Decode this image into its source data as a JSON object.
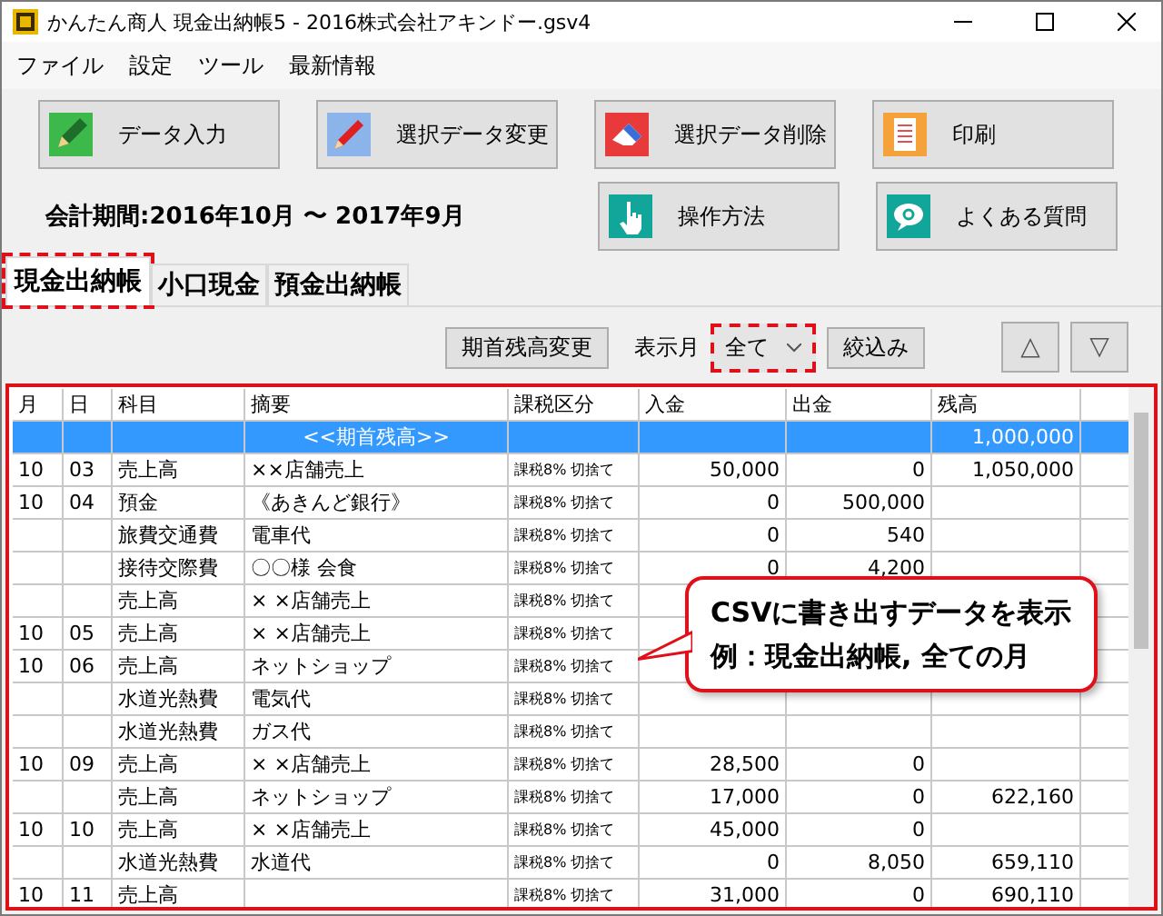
{
  "window": {
    "title": "かんたん商人 現金出納帳5 - 2016株式会社アキンドー.gsv4"
  },
  "menu": [
    "ファイル",
    "設定",
    "ツール",
    "最新情報"
  ],
  "buttons": [
    {
      "label": "データ入力",
      "kind": "pencil"
    },
    {
      "label": "選択データ変更",
      "kind": "pen"
    },
    {
      "label": "選択データ削除",
      "kind": "eraser"
    },
    {
      "label": "印刷",
      "kind": "print"
    }
  ],
  "period": "会計期間:2016年10月 〜 2017年9月",
  "help_buttons": [
    {
      "label": "操作方法",
      "kind": "hand"
    },
    {
      "label": "よくある質問",
      "kind": "faq"
    }
  ],
  "tabs": [
    {
      "label": "現金出納帳",
      "selected": true,
      "highlighted": true
    },
    {
      "label": "小口現金",
      "selected": false,
      "highlighted": false
    },
    {
      "label": "預金出納帳",
      "selected": false,
      "highlighted": false
    }
  ],
  "toolbar": {
    "opening_button": "期首残高変更",
    "month_label": "表示月",
    "month_value": "全て",
    "month_highlighted": true,
    "filter_button": "絞込み",
    "up": "△",
    "down": "▽"
  },
  "table": {
    "highlighted": true,
    "columns": [
      "月",
      "日",
      "科目",
      "摘要",
      "課税区分",
      "入金",
      "出金",
      "残高"
    ],
    "rows": [
      {
        "kind": "opening",
        "selected": true,
        "cells": [
          "",
          "",
          "",
          "<<期首残高>>",
          "",
          "",
          "",
          "1,000,000"
        ]
      },
      {
        "kind": "entry",
        "selected": false,
        "cells": [
          "10",
          "03",
          "売上高",
          "××店舗売上",
          "課税8% 切捨て",
          "50,000",
          "0",
          "1,050,000"
        ]
      },
      {
        "kind": "entry",
        "selected": false,
        "cells": [
          "10",
          "04",
          "預金",
          "《あきんど銀行》",
          "課税8% 切捨て",
          "0",
          "500,000",
          ""
        ]
      },
      {
        "kind": "entry",
        "selected": false,
        "cells": [
          "",
          "",
          "旅費交通費",
          "電車代",
          "課税8% 切捨て",
          "0",
          "540",
          ""
        ]
      },
      {
        "kind": "entry",
        "selected": false,
        "cells": [
          "",
          "",
          "接待交際費",
          "〇〇様 会食",
          "課税8% 切捨て",
          "0",
          "4,200",
          ""
        ]
      },
      {
        "kind": "entry",
        "selected": false,
        "cells": [
          "",
          "",
          "売上高",
          "× ×店舗売上",
          "課税8% 切捨て",
          "",
          "",
          ""
        ]
      },
      {
        "kind": "entry",
        "selected": false,
        "cells": [
          "10",
          "05",
          "売上高",
          "× ×店舗売上",
          "課税8% 切捨て",
          "",
          "",
          ""
        ]
      },
      {
        "kind": "entry",
        "selected": false,
        "cells": [
          "10",
          "06",
          "売上高",
          "ネットショップ",
          "課税8% 切捨て",
          "",
          "",
          ""
        ]
      },
      {
        "kind": "entry",
        "selected": false,
        "cells": [
          "",
          "",
          "水道光熱費",
          "電気代",
          "課税8% 切捨て",
          "",
          "",
          ""
        ]
      },
      {
        "kind": "entry",
        "selected": false,
        "cells": [
          "",
          "",
          "水道光熱費",
          "ガス代",
          "課税8% 切捨て",
          "",
          "",
          ""
        ]
      },
      {
        "kind": "entry",
        "selected": false,
        "cells": [
          "10",
          "09",
          "売上高",
          "× ×店舗売上",
          "課税8% 切捨て",
          "28,500",
          "0",
          ""
        ]
      },
      {
        "kind": "entry",
        "selected": false,
        "cells": [
          "",
          "",
          "売上高",
          "ネットショップ",
          "課税8% 切捨て",
          "17,000",
          "0",
          "622,160"
        ]
      },
      {
        "kind": "entry",
        "selected": false,
        "cells": [
          "10",
          "10",
          "売上高",
          "× ×店舗売上",
          "課税8% 切捨て",
          "45,000",
          "0",
          ""
        ]
      },
      {
        "kind": "entry",
        "selected": false,
        "cells": [
          "",
          "",
          "水道光熱費",
          "水道代",
          "課税8% 切捨て",
          "0",
          "8,050",
          "659,110"
        ]
      },
      {
        "kind": "entry",
        "selected": false,
        "cells": [
          "10",
          "11",
          "売上高",
          "",
          "課税8% 切捨て",
          "31,000",
          "0",
          "690,110"
        ]
      }
    ]
  },
  "callout": [
    "CSVに書き出すデータを表示",
    "例：現金出納帳, 全ての月"
  ]
}
